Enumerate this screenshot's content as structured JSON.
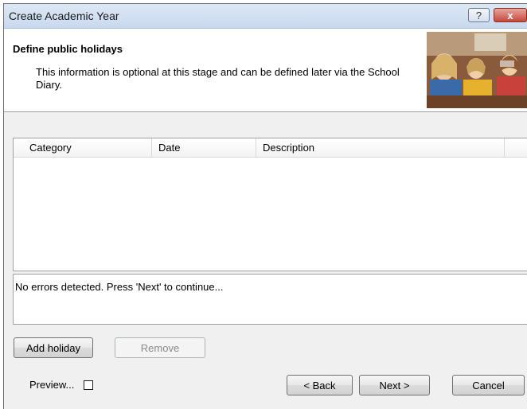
{
  "window": {
    "title": "Create Academic Year",
    "help_label": "?",
    "close_label": "x"
  },
  "header": {
    "title": "Define public holidays",
    "description": "This information is optional at this stage and can be defined later via the School Diary."
  },
  "grid": {
    "columns": [
      "Category",
      "Date",
      "Description",
      ""
    ],
    "rows": []
  },
  "status": {
    "message": "No errors detected. Press 'Next' to continue..."
  },
  "actions": {
    "add_label": "Add holiday",
    "remove_label": "Remove"
  },
  "footer": {
    "preview_label": "Preview...",
    "preview_checked": false,
    "back_label": "< Back",
    "next_label": "Next >",
    "cancel_label": "Cancel"
  }
}
